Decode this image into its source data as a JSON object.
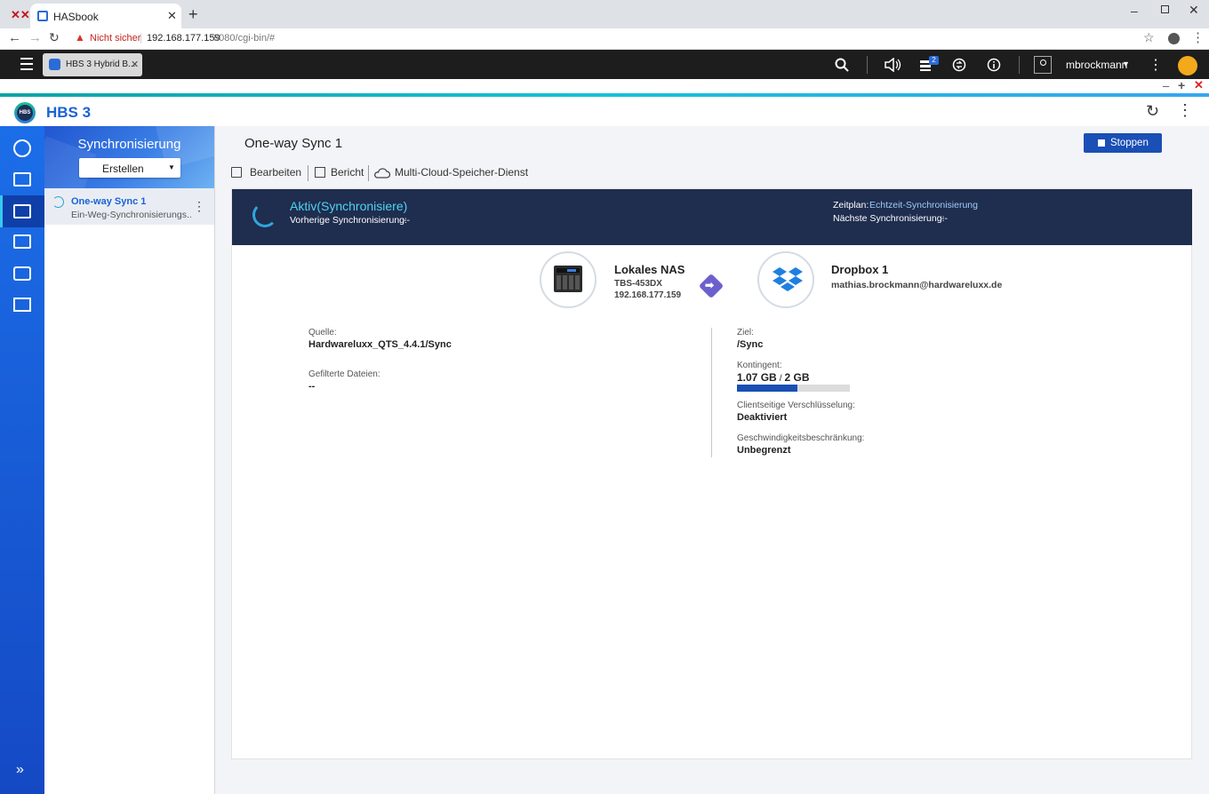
{
  "browser": {
    "tab_title": "HASbook",
    "address_warning": "Nicht sicher",
    "url_host": "192.168.177.159",
    "url_rest": ":8080/cgi-bin/#"
  },
  "qts": {
    "app_tab_label": "HBS 3 Hybrid B...",
    "notification_count": "2",
    "username": "mbrockmann"
  },
  "app": {
    "title": "HBS 3",
    "logo_text": "HBS"
  },
  "sidebar": {
    "header_title": "Synchronisierung",
    "create_button": "Erstellen",
    "jobs": [
      {
        "name": "One-way Sync 1",
        "subtitle": "Ein-Weg-Synchronisierungs..."
      }
    ]
  },
  "main": {
    "job_title": "One-way Sync 1",
    "stop_button": "Stoppen",
    "actions": {
      "edit": "Bearbeiten",
      "report": "Bericht",
      "multicloud": "Multi-Cloud-Speicher-Dienst"
    },
    "status": {
      "state": "Aktiv(Synchronisiere)",
      "previous_label": "Vorherige Synchronisierung:",
      "previous_value": "--",
      "schedule_label": "Zeitplan:",
      "schedule_value": "Echtzeit-Synchronisierung",
      "next_label": "Nächste Synchronisierung:",
      "next_value": "--"
    },
    "source_device": {
      "name": "Lokales NAS",
      "model": "TBS-453DX",
      "ip": "192.168.177.159"
    },
    "target_device": {
      "name": "Dropbox 1",
      "account": "mathias.brockmann@hardwareluxx.de"
    },
    "left_details": {
      "source_label": "Quelle:",
      "source_value": "Hardwareluxx_QTS_4.4.1/Sync",
      "filtered_label": "Gefilterte Dateien:",
      "filtered_value": "--"
    },
    "right_details": {
      "target_label": "Ziel:",
      "target_value": "/Sync",
      "quota_label": "Kontingent:",
      "quota_used": "1.07 GB",
      "quota_sep": "/",
      "quota_total": "2 GB",
      "quota_fraction": 0.535,
      "encryption_label": "Clientseitige Verschlüsselung:",
      "encryption_value": "Deaktiviert",
      "speed_label": "Geschwindigkeitsbeschränkung:",
      "speed_value": "Unbegrenzt"
    }
  },
  "colors": {
    "accent": "#1a62d8",
    "status_bg": "#1f2d4f",
    "status_text": "#4fd3f0",
    "quota_bar": "#1a4fb5"
  }
}
